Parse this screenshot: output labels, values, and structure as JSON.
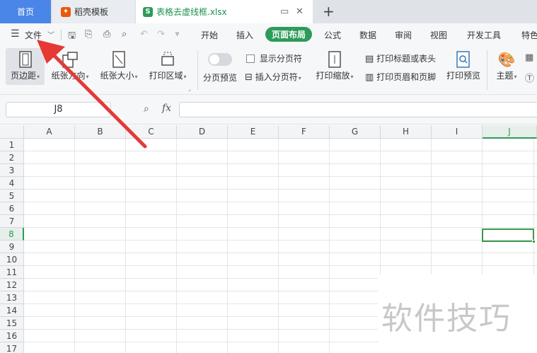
{
  "tabs": {
    "home": "首页",
    "docer": "稻壳模板",
    "file": "表格去虚线框.xlsx",
    "new_tab": "+"
  },
  "menu": {
    "file_menu": "文件",
    "items": [
      "开始",
      "插入",
      "页面布局",
      "公式",
      "数据",
      "审阅",
      "视图",
      "开发工具",
      "特色"
    ],
    "active": "页面布局"
  },
  "ribbon": {
    "margins": "页边距",
    "orientation": "纸张方向",
    "size": "纸张大小",
    "print_area": "打印区域",
    "page_break_preview": "分页预览",
    "show_page_breaks": "显示分页符",
    "insert_page_break": "插入分页符",
    "print_scaling": "打印缩放",
    "print_titles": "打印标题或表头",
    "header_footer": "打印页眉和页脚",
    "print_preview": "打印预览",
    "theme": "主题"
  },
  "formula_bar": {
    "name_box": "J8",
    "fx": "fx",
    "value": ""
  },
  "grid": {
    "columns": [
      "A",
      "B",
      "C",
      "D",
      "E",
      "F",
      "G",
      "H",
      "I",
      "J"
    ],
    "rows": [
      "1",
      "2",
      "3",
      "4",
      "5",
      "6",
      "7",
      "8",
      "9",
      "10",
      "11",
      "12",
      "13",
      "14",
      "15",
      "16",
      "17"
    ],
    "active_cell": "J8"
  },
  "watermark": "软件技巧",
  "colors": {
    "accent_green": "#2d9b5a",
    "home_tab_blue": "#4a86e8",
    "arrow_red": "#e53935"
  }
}
